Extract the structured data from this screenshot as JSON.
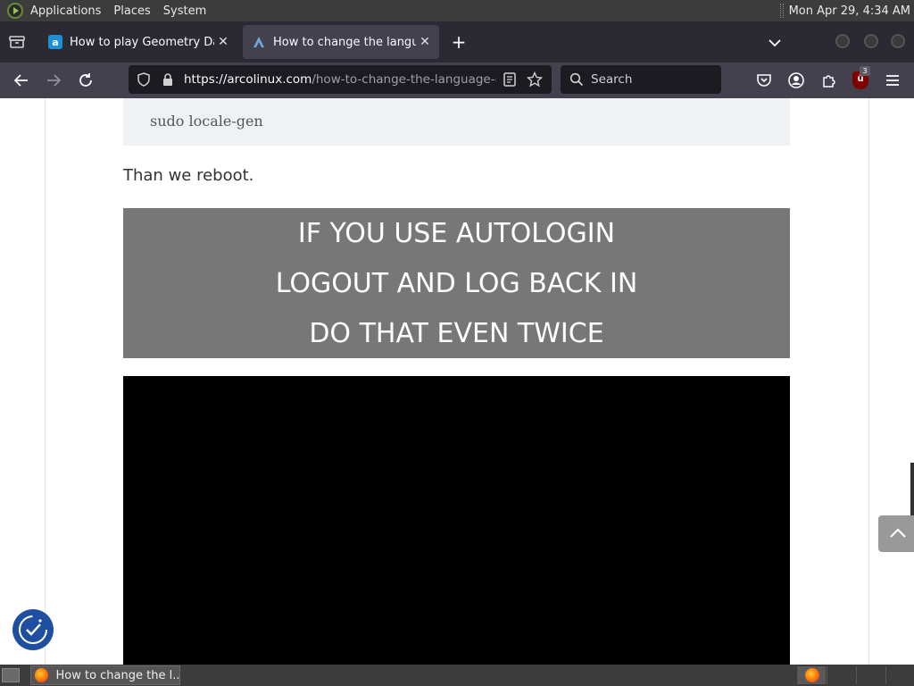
{
  "system_panel": {
    "menus": [
      "Applications",
      "Places",
      "System"
    ],
    "clock": "Mon Apr 29,  4:34 AM"
  },
  "tabs": [
    {
      "title": "How to play Geometry Dash",
      "favicon": "a",
      "active": false
    },
    {
      "title": "How to change the language",
      "favicon": "arcolinux-logo",
      "active": true
    }
  ],
  "toolbar": {
    "url_domain": "https://arcolinux.com",
    "url_path": "/how-to-change-the-language-of-",
    "search_placeholder": "Search",
    "ublock_badge": "3"
  },
  "article": {
    "code": "sudo locale-gen",
    "paragraph": "Than we reboot.",
    "notice_lines": [
      "IF YOU USE AUTOLOGIN",
      "LOGOUT AND LOG BACK IN",
      "DO THAT EVEN TWICE"
    ]
  },
  "taskbar": {
    "window_title": "How to change the l..."
  },
  "colors": {
    "tab_strip": "#2b2a33",
    "toolbar": "#42414d",
    "notice_bg": "#777777",
    "accessibility_button": "#1e4fa0"
  }
}
